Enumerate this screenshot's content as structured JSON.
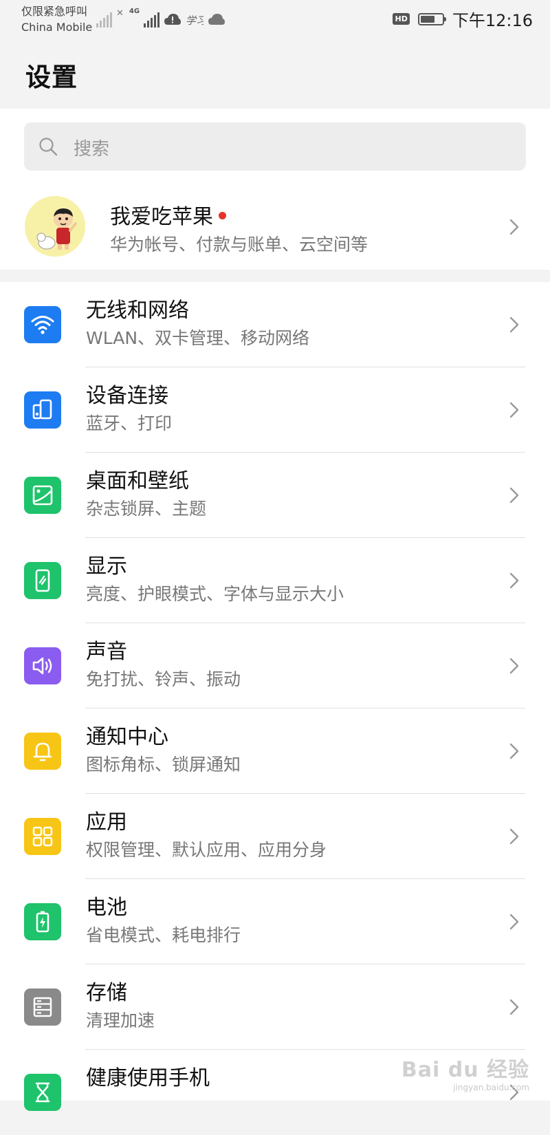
{
  "status_bar": {
    "carrier_line1": "仅限紧急呼叫",
    "carrier_line2": "China Mobile",
    "network_type": "4G",
    "hd_badge": "HD",
    "battery_level": 0.7,
    "time": "下午12:16"
  },
  "header": {
    "title": "设置"
  },
  "search": {
    "placeholder": "搜索"
  },
  "account": {
    "name": "我爱吃苹果",
    "subtitle": "华为帐号、付款与账单、云空间等"
  },
  "settings_items": [
    {
      "title": "无线和网络",
      "subtitle": "WLAN、双卡管理、移动网络",
      "icon": "wifi-icon",
      "color": "#1e7cf2"
    },
    {
      "title": "设备连接",
      "subtitle": "蓝牙、打印",
      "icon": "device-connect-icon",
      "color": "#1e7cf2"
    },
    {
      "title": "桌面和壁纸",
      "subtitle": "杂志锁屏、主题",
      "icon": "wallpaper-icon",
      "color": "#1ec36b"
    },
    {
      "title": "显示",
      "subtitle": "亮度、护眼模式、字体与显示大小",
      "icon": "display-icon",
      "color": "#1ec36b"
    },
    {
      "title": "声音",
      "subtitle": "免打扰、铃声、振动",
      "icon": "sound-icon",
      "color": "#8b5cf0"
    },
    {
      "title": "通知中心",
      "subtitle": "图标角标、锁屏通知",
      "icon": "bell-icon",
      "color": "#f7c515"
    },
    {
      "title": "应用",
      "subtitle": "权限管理、默认应用、应用分身",
      "icon": "apps-grid-icon",
      "color": "#f7c515"
    },
    {
      "title": "电池",
      "subtitle": "省电模式、耗电排行",
      "icon": "battery-icon",
      "color": "#1ec36b"
    },
    {
      "title": "存储",
      "subtitle": "清理加速",
      "icon": "storage-icon",
      "color": "#8a8a8a"
    },
    {
      "title": "健康使用手机",
      "subtitle": "",
      "icon": "hourglass-icon",
      "color": "#1ec36b"
    }
  ],
  "watermark": {
    "main": "Bai du 经验",
    "sub": "jingyan.baidu.com"
  }
}
